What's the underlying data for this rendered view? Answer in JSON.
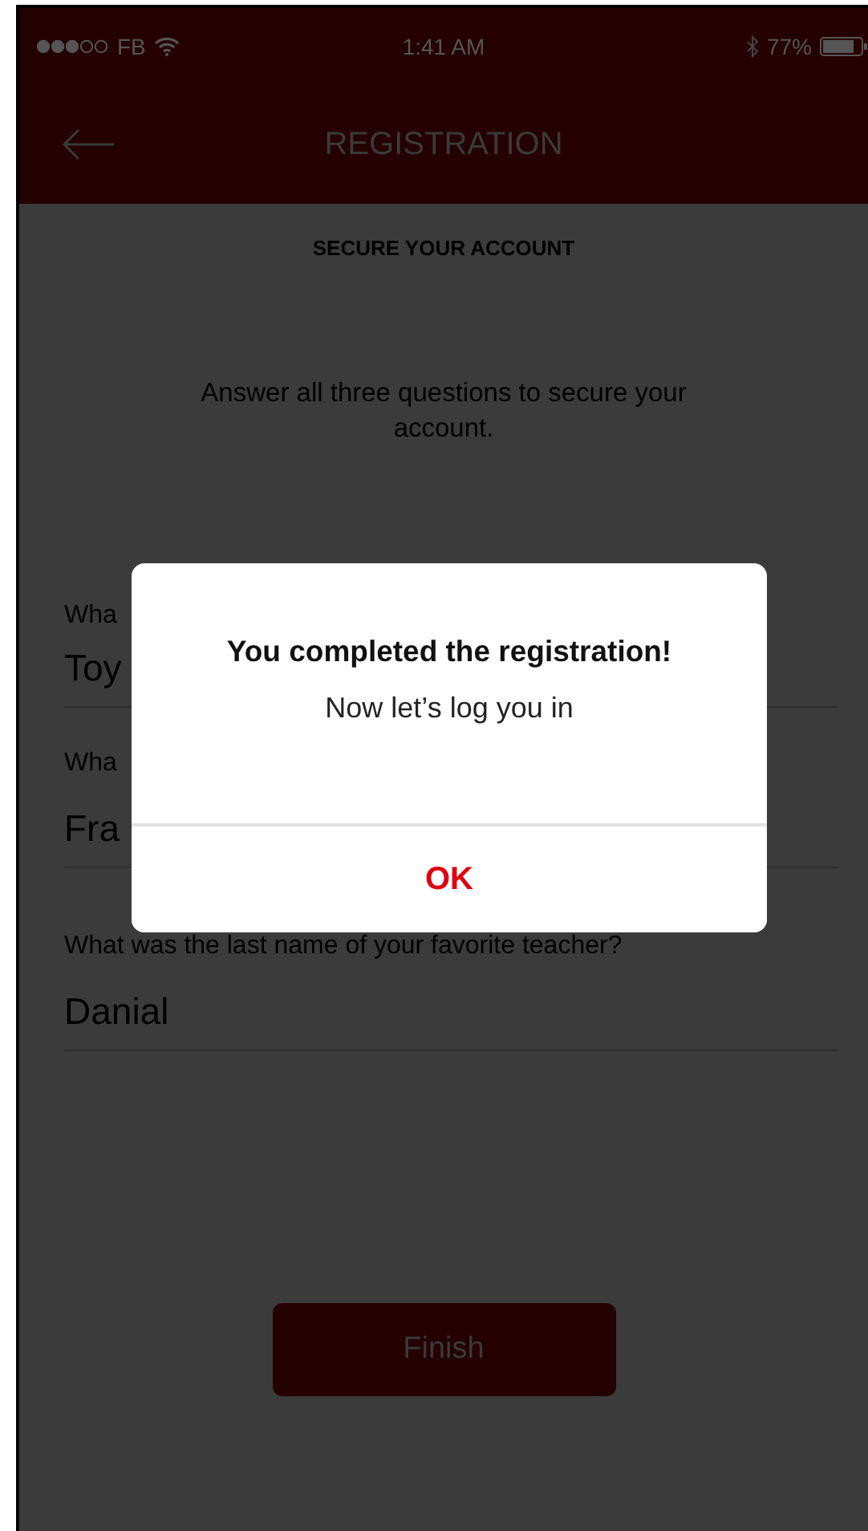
{
  "status_bar": {
    "carrier": "FB",
    "time": "1:41 AM",
    "battery": "77%"
  },
  "nav": {
    "title": "REGISTRATION"
  },
  "section_title": "SECURE YOUR ACCOUNT",
  "instructions": "Answer all three questions to secure your account.",
  "questions": [
    {
      "label": "Wha",
      "answer": "Toy"
    },
    {
      "label": "Wha",
      "answer": "Fra"
    },
    {
      "label": "What was the last name of your favorite teacher?",
      "answer": "Danial"
    }
  ],
  "finish_button": "Finish",
  "dialog": {
    "title": "You completed the registration!",
    "message": "Now let’s log you in",
    "button": "OK"
  }
}
